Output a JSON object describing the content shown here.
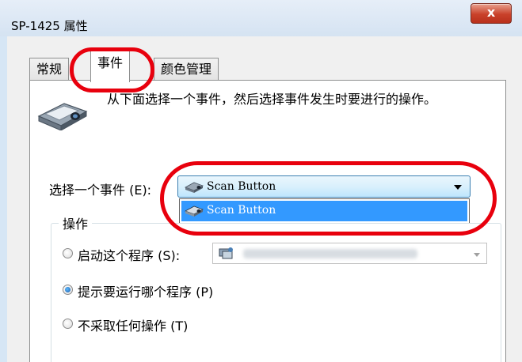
{
  "window": {
    "title": "SP-1425 属性",
    "close_label": "x"
  },
  "tabs": [
    {
      "label": "常规",
      "active": false
    },
    {
      "label": "事件",
      "active": true
    },
    {
      "label": "颜色管理",
      "active": false
    }
  ],
  "description": "从下面选择一个事件，然后选择事件发生时要进行的操作。",
  "event": {
    "label": "选择一个事件 (E):",
    "selected": "Scan Button",
    "options": [
      "Scan Button"
    ]
  },
  "actions": {
    "group_title": "操作",
    "options": [
      {
        "label": "启动这个程序 (S):",
        "selected": false
      },
      {
        "label": "提示要运行哪个程序 (P)",
        "selected": true
      },
      {
        "label": "不采取任何操作 (T)",
        "selected": false
      }
    ]
  },
  "icons": {
    "scanner": "scanner-icon",
    "program": "program-icon"
  },
  "colors": {
    "highlight": "#3399ff",
    "annotation": "#e8000d"
  }
}
